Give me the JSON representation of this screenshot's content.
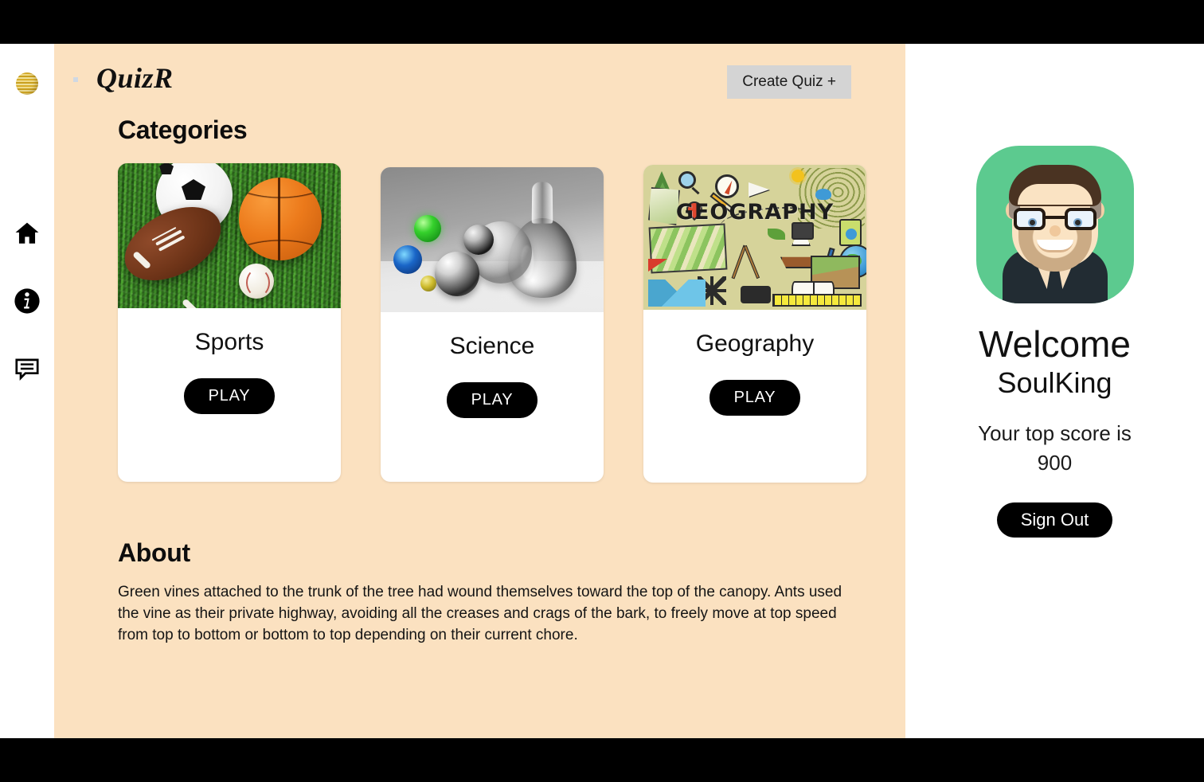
{
  "brand": {
    "name": "QuizR",
    "logo_icon": "bee-hive-sphere-logo"
  },
  "sidebar": {
    "items": [
      {
        "icon": "home-icon",
        "label": "Home"
      },
      {
        "icon": "info-icon",
        "label": "Info"
      },
      {
        "icon": "comment-icon",
        "label": "Feedback"
      }
    ]
  },
  "header": {
    "create_quiz_label": "Create Quiz +"
  },
  "main": {
    "categories_heading": "Categories",
    "about_heading": "About",
    "about_text": "Green vines attached to the trunk of the tree had wound themselves toward the top of the canopy. Ants used the vine as their private highway, avoiding all the creases and crags of the bark, to freely move at top speed from top to bottom or bottom to top depending on their current chore.",
    "cards": [
      {
        "title": "Sports",
        "play_label": "PLAY",
        "image_alt": "soccer-basketball-football-baseball-on-grass"
      },
      {
        "title": "Science",
        "play_label": "PLAY",
        "image_alt": "glass-decanter-and-spheres-grayscale"
      },
      {
        "title": "Geography",
        "play_label": "PLAY",
        "image_alt": "geography-doodle-collage",
        "image_word": "GEOGRAPHY"
      }
    ]
  },
  "profile": {
    "avatar_alt": "male-avatar-with-glasses-and-beard",
    "welcome_label": "Welcome",
    "username": "SoulKing",
    "score_label": "Your top score is",
    "score_value": "900",
    "signout_label": "Sign Out"
  },
  "colors": {
    "page_background": "#fbe1c0",
    "panel_background": "#ffffff",
    "frame": "#000000",
    "avatar_background": "#5cca8f",
    "create_quiz_background": "#d4d4d4",
    "button_background": "#000000"
  }
}
